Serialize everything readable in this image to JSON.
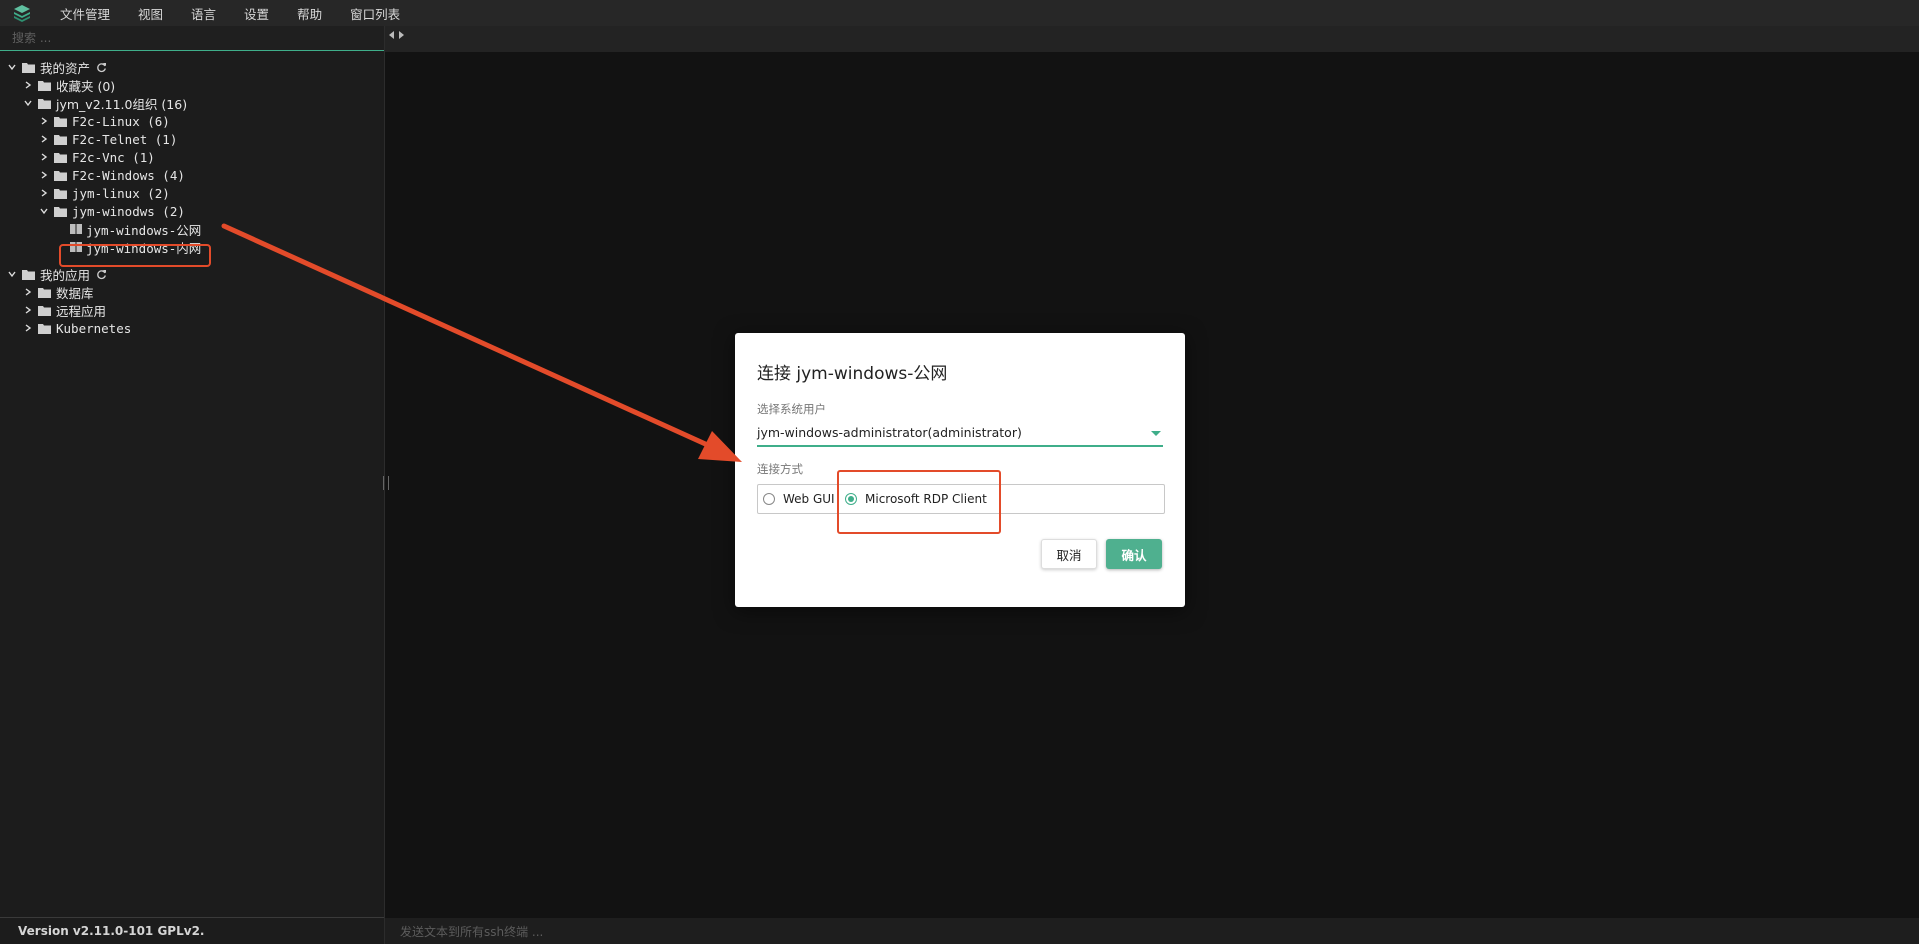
{
  "menubar": {
    "logo_icon": "stack-logo-icon",
    "items": [
      "文件管理",
      "视图",
      "语言",
      "设置",
      "帮助",
      "窗口列表"
    ]
  },
  "search": {
    "placeholder": "搜索 ..."
  },
  "tree": {
    "my_assets": "我的资产",
    "favorites": "收藏夹 (0)",
    "org": "jym_v2.11.0组织 (16)",
    "f2c_linux": "F2c-Linux (6)",
    "f2c_telnet": "F2c-Telnet (1)",
    "f2c_vnc": "F2c-Vnc (1)",
    "f2c_windows": "F2c-Windows (4)",
    "jym_linux": "jym-linux (2)",
    "jym_winodws": "jym-winodws (2)",
    "win_public": "jym-windows-公网",
    "win_internal": "jym-windows-内网",
    "my_apps": "我的应用",
    "database": "数据库",
    "remote_app": "远程应用",
    "kubernetes": "Kubernetes"
  },
  "version": "Version v2.11.0-101 GPLv2.",
  "bottom_bar": {
    "placeholder": "发送文本到所有ssh终端 ..."
  },
  "dialog": {
    "title": "连接 jym-windows-公网",
    "user_label": "选择系统用户",
    "user_value": "jym-windows-administrator(administrator)",
    "method_label": "连接方式",
    "options": [
      {
        "label": "Web GUI",
        "checked": false
      },
      {
        "label": "Microsoft RDP Client",
        "checked": true
      }
    ],
    "cancel": "取消",
    "ok": "确认"
  },
  "colors": {
    "accent": "#3fae8a",
    "annotation": "#e34b2a",
    "ok_button": "#4fb08f"
  }
}
